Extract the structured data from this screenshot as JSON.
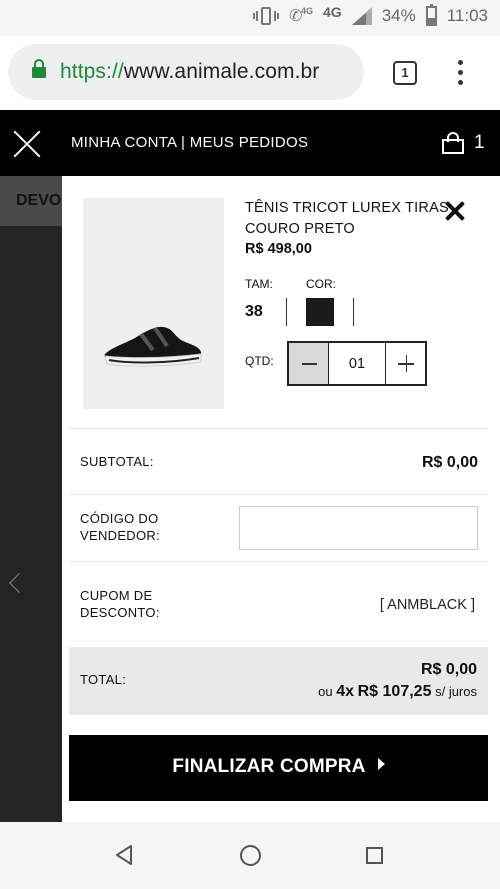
{
  "status_bar": {
    "battery_percent": "34%",
    "time": "11:03",
    "network": "4G",
    "call_network": "4G",
    "icons": [
      "vibrate-icon",
      "wifi-call-icon",
      "signal-icon",
      "battery-icon"
    ]
  },
  "browser": {
    "url_scheme": "https://",
    "url_host": "www.animale.com.br",
    "tab_count": "1"
  },
  "header": {
    "account_link": "MINHA CONTA",
    "separator": "|",
    "orders_link": "MEUS PEDIDOS",
    "bag_count": "1"
  },
  "background": {
    "partial_text": "DEVO"
  },
  "cart": {
    "product": {
      "title": "TÊNIS TRICOT LUREX TIRAS COURO PRETO",
      "price": "R$ 498,00",
      "size_label": "TAM:",
      "size_value": "38",
      "color_label": "COR:",
      "color_swatch": "#1a1a1a",
      "qty_label": "QTD:",
      "qty_value": "01"
    },
    "subtotal_label": "SUBTOTAL:",
    "subtotal_value": "R$ 0,00",
    "seller_code_label_1": "CÓDIGO DO",
    "seller_code_label_2": "VENDEDOR:",
    "seller_code_value": "",
    "coupon_label_1": "CUPOM DE",
    "coupon_label_2": "DESCONTO:",
    "coupon_value": "[ ANMBLACK ]",
    "total_label": "TOTAL:",
    "total_value": "R$ 0,00",
    "installments_prefix": "ou",
    "installments_count": "4x",
    "installments_value": "R$ 107,25",
    "installments_suffix": "s/ juros",
    "checkout_button": "FINALIZAR COMPRA"
  },
  "colors": {
    "header_bg": "#000000",
    "url_green": "#1b8a3a",
    "overlay_bg": "#242424",
    "total_bg": "#e9e9e9"
  }
}
